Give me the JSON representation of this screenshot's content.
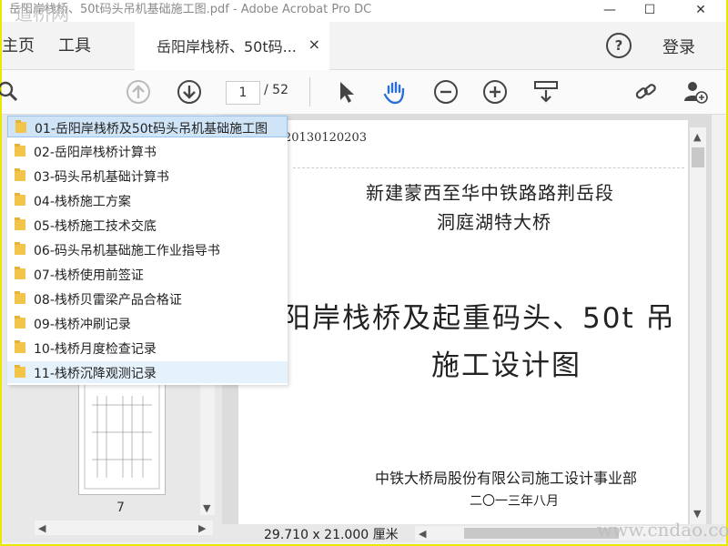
{
  "window": {
    "title": "岳阳岸栈桥、50t码头吊机基础施工图.pdf - Adobe Acrobat Pro DC",
    "watermark": "道桥网",
    "minimize": "—",
    "maximize": "☐",
    "close": "✕"
  },
  "tabs": {
    "home": "主页",
    "tools": "工具",
    "document": "岳阳岸栈桥、50t码...",
    "close": "×",
    "help": "?",
    "login": "登录"
  },
  "toolbar": {
    "current_page": "1",
    "total_pages": "/ 52",
    "icons": [
      "search-icon",
      "prev-page-icon",
      "next-page-icon",
      "select-arrow-icon",
      "hand-tool-icon",
      "zoom-out-icon",
      "zoom-in-icon",
      "page-view-icon",
      "share-link-icon",
      "add-user-icon"
    ]
  },
  "menu": {
    "items": [
      {
        "label": "01-岳阳岸栈桥及50t码头吊机基础施工图"
      },
      {
        "label": "02-岳阳岸栈桥计算书"
      },
      {
        "label": "03-码头吊机基础计算书"
      },
      {
        "label": "04-栈桥施工方案"
      },
      {
        "label": "05-栈桥施工技术交底"
      },
      {
        "label": "06-码头吊机基础施工作业指导书"
      },
      {
        "label": "07-栈桥使用前签证"
      },
      {
        "label": "08-栈桥贝雷梁产品合格证"
      },
      {
        "label": "09-栈桥冲刷记录"
      },
      {
        "label": "10-栈桥月度检查记录"
      },
      {
        "label": "11-栈桥沉降观测记录"
      }
    ]
  },
  "thumbnail": {
    "page_number": "7"
  },
  "page": {
    "code": "20130120203",
    "line1": "新建蒙西至华中铁路路荆岳段",
    "line2": "洞庭湖特大桥",
    "big1": "阳岸栈桥及起重码头、50t 吊",
    "big2": "施工设计图",
    "org": "中铁大桥局股份有限公司施工设计事业部",
    "date": "二〇一三年八月"
  },
  "status": {
    "dimensions": "29.710 x 21.000 厘米"
  },
  "footer_watermark": "www.cndao.com"
}
